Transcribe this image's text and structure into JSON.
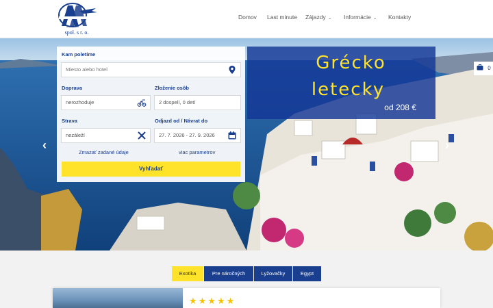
{
  "header": {
    "logo_text": "ALBATROS",
    "logo_sub": "spol. s r. o.",
    "nav": [
      {
        "label": "Domov",
        "dropdown": false
      },
      {
        "label": "Last minute",
        "dropdown": false
      },
      {
        "label": "Zájazdy",
        "dropdown": true
      },
      {
        "label": "Informácie",
        "dropdown": true
      },
      {
        "label": "Kontakty",
        "dropdown": false
      }
    ]
  },
  "search": {
    "destination_label": "Kam poletíme",
    "destination_placeholder": "Miesto alebo hotel",
    "transport_label": "Doprava",
    "transport_value": "nerozhoduje",
    "persons_label": "Zloženie osôb",
    "persons_value": "2 dospelí, 0 detí",
    "board_label": "Strava",
    "board_value": "nezáleží",
    "dates_label": "Odjazd od / Návrat do",
    "dates_value": "27. 7. 2026 - 27. 9. 2026",
    "clear_link": "Zmazať zadané údaje",
    "more_link": "viac parametrov",
    "search_button": "Vyhľadať"
  },
  "promo": {
    "line1": "Grécko",
    "line2": "letecky",
    "price": "od 208 €"
  },
  "cart": {
    "count": "0",
    "icon": "briefcase-icon"
  },
  "tabs": [
    {
      "label": "Exotika",
      "active": true
    },
    {
      "label": "Pre náročných",
      "active": false
    },
    {
      "label": "Lyžovačky",
      "active": false
    },
    {
      "label": "Egypt",
      "active": false
    }
  ],
  "card": {
    "stars": "★★★★★",
    "rating": 5
  },
  "colors": {
    "brand_blue": "#1b3f8f",
    "accent_yellow": "#ffe22a",
    "promo_bg": "#133796"
  }
}
